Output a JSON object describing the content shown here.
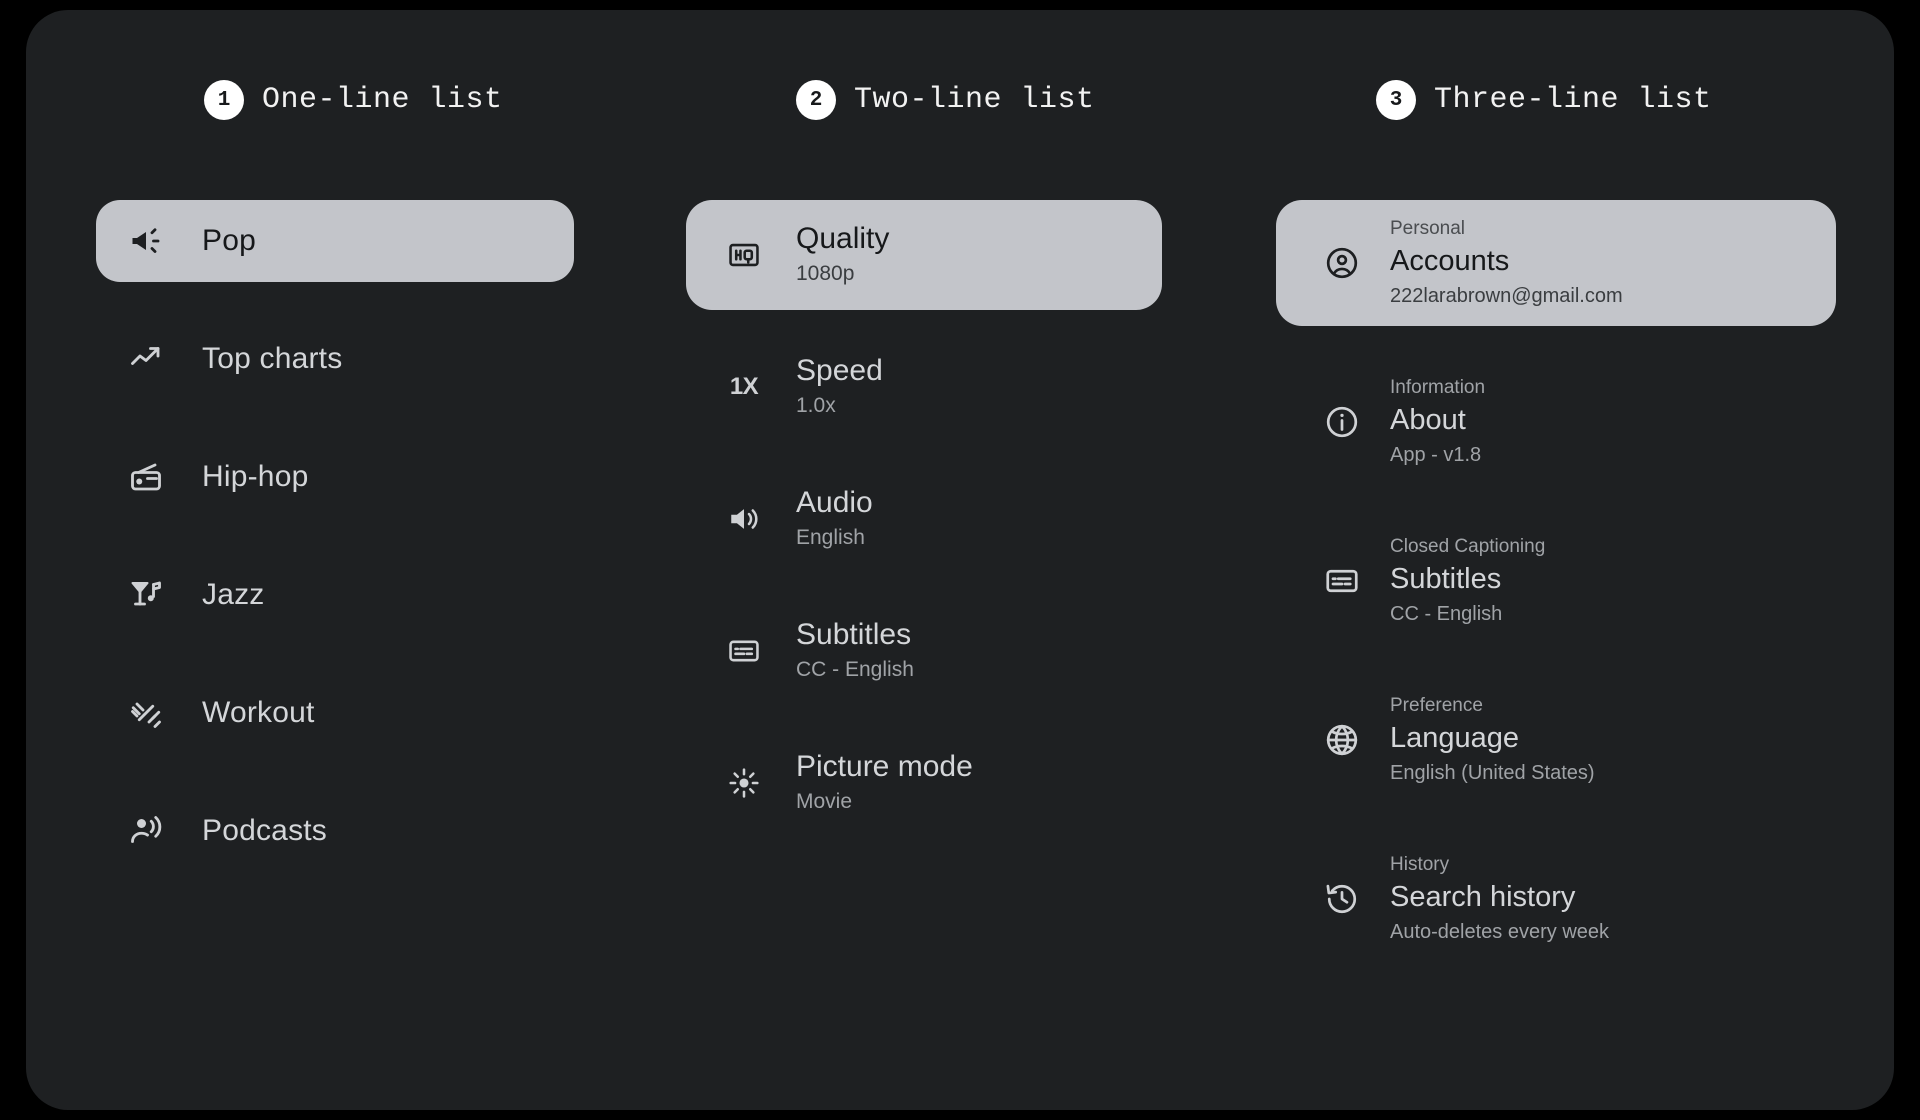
{
  "canvas": {
    "background": "#1e2022",
    "page_background": "#000000",
    "selected_background": "#c3c5ca"
  },
  "columns": [
    {
      "number": "1",
      "title": "One-line list",
      "items": [
        {
          "icon": "campaign-icon",
          "title": "Pop",
          "selected": true
        },
        {
          "icon": "trending-up-icon",
          "title": "Top charts",
          "selected": false
        },
        {
          "icon": "radio-icon",
          "title": "Hip-hop",
          "selected": false
        },
        {
          "icon": "nightlife-icon",
          "title": "Jazz",
          "selected": false
        },
        {
          "icon": "dumbbell-icon",
          "title": "Workout",
          "selected": false
        },
        {
          "icon": "podcasts-icon",
          "title": "Podcasts",
          "selected": false
        }
      ]
    },
    {
      "number": "2",
      "title": "Two-line list",
      "items": [
        {
          "icon": "hq-icon",
          "title": "Quality",
          "sub": "1080p",
          "selected": true
        },
        {
          "icon": "speed-1x-icon",
          "title": "Speed",
          "sub": "1.0x",
          "selected": false
        },
        {
          "icon": "volume-up-icon",
          "title": "Audio",
          "sub": "English",
          "selected": false
        },
        {
          "icon": "closed-caption-icon",
          "title": "Subtitles",
          "sub": "CC - English",
          "selected": false
        },
        {
          "icon": "brightness-icon",
          "title": "Picture mode",
          "sub": "Movie",
          "selected": false
        }
      ]
    },
    {
      "number": "3",
      "title": "Three-line list",
      "items": [
        {
          "icon": "account-circle-icon",
          "over": "Personal",
          "title": "Accounts",
          "sub": "222larabrown@gmail.com",
          "selected": true
        },
        {
          "icon": "info-icon",
          "over": "Information",
          "title": "About",
          "sub": "App - v1.8",
          "selected": false
        },
        {
          "icon": "closed-caption-icon",
          "over": "Closed Captioning",
          "title": "Subtitles",
          "sub": "CC - English",
          "selected": false
        },
        {
          "icon": "globe-icon",
          "over": "Preference",
          "title": "Language",
          "sub": "English (United States)",
          "selected": false
        },
        {
          "icon": "history-icon",
          "over": "History",
          "title": "Search history",
          "sub": "Auto-deletes every week",
          "selected": false
        }
      ]
    }
  ]
}
